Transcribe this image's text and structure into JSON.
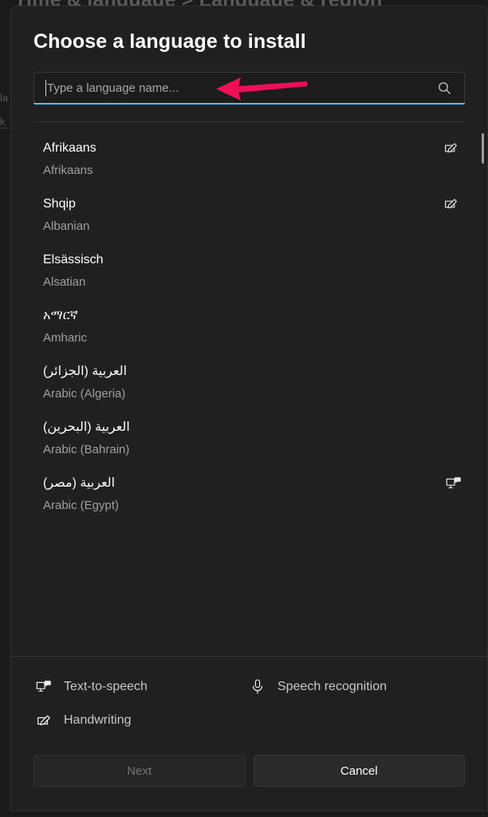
{
  "backdrop": {
    "title_fragment": "Time & language  >  Language & region",
    "left_fragments": [
      "la",
      "k"
    ]
  },
  "dialog": {
    "title": "Choose a language to install",
    "search": {
      "placeholder": "Type a language name...",
      "value": "",
      "icon": "search-icon"
    },
    "annotation": {
      "type": "arrow-pointer",
      "direction": "left",
      "color": "#ef0f58",
      "target": "search-input"
    },
    "languages": [
      {
        "native": "Afrikaans",
        "english": "Afrikaans",
        "rtl": false,
        "feature": "handwriting"
      },
      {
        "native": "Shqip",
        "english": "Albanian",
        "rtl": false,
        "feature": "handwriting"
      },
      {
        "native": "Elsässisch",
        "english": "Alsatian",
        "rtl": false,
        "feature": null
      },
      {
        "native": "አማርኛ",
        "english": "Amharic",
        "rtl": false,
        "feature": null
      },
      {
        "native": "العربية (الجزائر)",
        "english": "Arabic (Algeria)",
        "rtl": true,
        "feature": null
      },
      {
        "native": "العربية (البحرين)",
        "english": "Arabic (Bahrain)",
        "rtl": true,
        "feature": null
      },
      {
        "native": "العربية (مصر)",
        "english": "Arabic (Egypt)",
        "rtl": true,
        "feature": "text-to-speech"
      }
    ],
    "legend": {
      "text_to_speech": "Text-to-speech",
      "speech_recognition": "Speech recognition",
      "handwriting": "Handwriting"
    },
    "actions": {
      "next": "Next",
      "next_disabled": true,
      "cancel": "Cancel"
    }
  },
  "colors": {
    "accent": "#4cc2ff",
    "dialog_bg": "#202020",
    "page_bg": "#1a1a1a",
    "arrow": "#ef0f58"
  }
}
